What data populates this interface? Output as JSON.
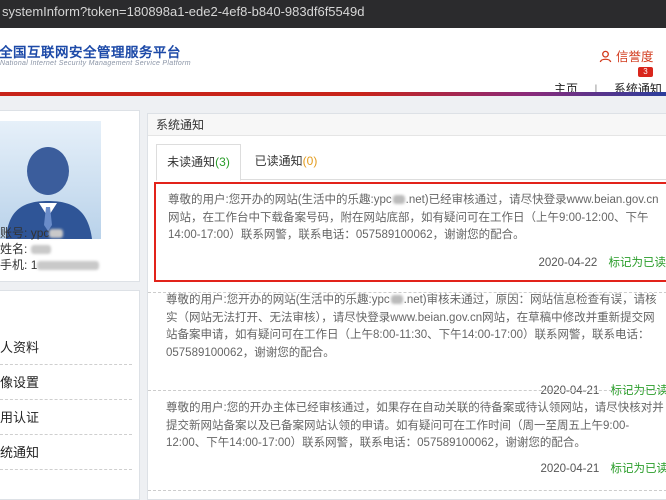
{
  "browser": {
    "url": "systemInform?token=180898a1-ede2-4ef8-b840-983df6f5549d"
  },
  "header": {
    "logo_cn": "全国互联网安全管理服务平台",
    "logo_en": "National Internet Security Management Service Platform",
    "credit_label": "信誉度",
    "badge_count": "3",
    "nav": [
      "主页",
      "系统通知"
    ]
  },
  "profile": {
    "account_label": "账号:",
    "account_value": "ypc",
    "name_label": "姓名:",
    "phone_label": "手机:",
    "phone_value": "1"
  },
  "menu": [
    "人资料",
    "像设置",
    "用认证",
    "统通知"
  ],
  "panel": {
    "title": "系统通知",
    "tabs": [
      {
        "label": "未读通知",
        "count": "3"
      },
      {
        "label": "已读通知",
        "count": "0"
      }
    ]
  },
  "notices": [
    {
      "text_a": "尊敬的用户:您开办的网站(生活中的乐趣:ypc",
      "text_b": ".net)已经审核通过，请尽快登录www.beian.gov.cn网站，在工作台中下载备案号码，附在网站底部，如有疑问可在工作日（上午9:00-12:00、下午14:00-17:00）联系网警，联系电话：057589100062，谢谢您的配合。",
      "date": "2020-04-22",
      "mark": "标记为已读"
    },
    {
      "text_a": "尊敬的用户:您开办的网站(生活中的乐趣:ypc",
      "text_b": ".net)审核未通过，原因：网站信息检查有误，请核实（网站无法打开、无法审核），请尽快登录www.beian.gov.cn网站，在草稿中修改并重新提交网站备案申请，如有疑问可在工作日（上午8:00-11:30、下午14:00-17:00）联系网警，联系电话：057589100062，谢谢您的配合。",
      "date": "2020-04-21",
      "mark": "标记为已读"
    },
    {
      "text_a": "尊敬的用户:您的开办主体已经审核通过，如果存在自动关联的待备案或待认领网站，请尽快核对并提交新网站备案以及已备案网站认领的申请。如有疑问可在工作时间（周一至周五上午9:00-12:00、下午14:00-17:00）联系网警，联系电话：057589100062，谢谢您的配合。",
      "text_b": "",
      "date": "2020-04-21",
      "mark": "标记为已读"
    }
  ],
  "colors": {
    "accent_red": "#c8241a",
    "brand_blue": "#1d4aa8",
    "unread_green": "#2a9d2a",
    "read_orange": "#e39b1c"
  }
}
